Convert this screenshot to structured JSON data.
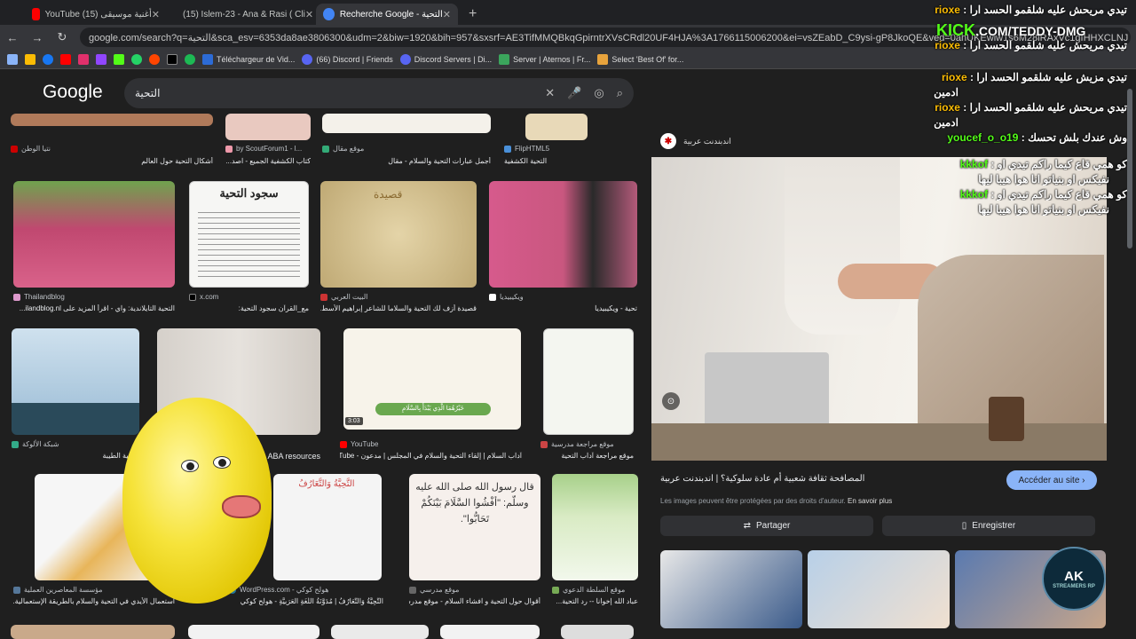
{
  "tabs": [
    {
      "label": "YouTube أغنية موسيقى (15)",
      "color": "#ff0000",
      "active": false
    },
    {
      "label": "(15) Islem-23 - Ana & Rasi ( Cli",
      "color": "#ff0000",
      "active": false
    },
    {
      "label": "Recherche Google - التحية",
      "color": "#4285f4",
      "active": true
    }
  ],
  "address": {
    "url": "google.com/search?q=التحية&sca_esv=6353da8ae3806300&udm=2&biw=1920&bih=957&sxsrf=AE3TifMMQBkqGpirntrXVsCRdl20UF4HJA%3A1766115006200&ei=vsZEabD_C9ysi-gP8JkoQE&ved=0ahUKEwiw1s6M28iRAxVc1gIHHXCLNJ"
  },
  "bookmarks": [
    {
      "label": "Téléchargeur de Vid...",
      "color": "#2c6bd6"
    },
    {
      "label": "(66) Discord | Friends",
      "color": "#5865f2"
    },
    {
      "label": "Discord Servers | Di...",
      "color": "#5865f2"
    },
    {
      "label": "Server | Aternos | Fr...",
      "color": "#3ba55c"
    },
    {
      "label": "Select 'Best Of' for...",
      "color": "#e8a33c"
    }
  ],
  "google": {
    "logo": "Google",
    "query": "التحية"
  },
  "grid": {
    "row0": [
      {
        "src": "نتيا الوطن",
        "cap": "أشكال التحية حول العالم",
        "color": "#b07a5a"
      },
      {
        "src": "by ScoutForum1 - l...",
        "cap": "كتاب الكشفية الجميع - اصد...",
        "color": "#e9c9c0"
      },
      {
        "src": "موقع مقال",
        "cap": "أجمل عبارات التحية والسلام - مقال",
        "color": "#f4f1ea"
      },
      {
        "src": "FlipHTML5",
        "cap": "التحية الكشفية",
        "color": "#e8d9b8"
      }
    ],
    "row1": [
      {
        "src": "Thailandblog",
        "cap": "التحية التايلاندية: واي - اقرأ المزيد على ilandblog.nl...",
        "color": "#c04870"
      },
      {
        "src": "x.com",
        "cap": "مع_القرآن سجود التحية:",
        "color": "#f1f1f1"
      },
      {
        "src": "البيت العربي",
        "cap": "قصيدة أزف لك التحية والسلاما للشاعر إبراهيم الأسط...",
        "color": "#d3c08f"
      },
      {
        "src": "ويكيبيديا",
        "cap": "تحية - ويكيبيديا",
        "color": "#c9577f"
      }
    ],
    "row2": [
      {
        "src": "شبكة الألوكة",
        "cap": "التحية الطيبة",
        "color": "#7fa8c8"
      },
      {
        "src": "",
        "cap": "ABA resources",
        "color": "#d7d2cc"
      },
      {
        "src": "YouTube",
        "cap": "آداب السلام | إلقاء التحية والسلام في المجلس | مدعون - uTube...",
        "color": "#f7f3ea",
        "duration": "3:03"
      },
      {
        "src": "موقع مراجعة مدرسية",
        "cap": "موقع مراجعة آداب التحية",
        "color": "#f4f6f0"
      }
    ],
    "row3": [
      {
        "src": "مؤسسة المعاصرين العملية",
        "cap": "استعمال الأيدي في التحية والسلام بالطريقة الإستعمالية...",
        "color": "#e8b55a"
      },
      {
        "src": "WordPress.com - هولح كوكي",
        "cap": "التَّحِيَّةُ وَالتَّعَارُفُ | مُدَوَّنَةُ اللُّغَةِ العَرَبِيَّةِ - هولح كوكي",
        "color": "#f4f4f4"
      },
      {
        "src": "موقع مدرسي",
        "cap": "أقوال حول التحية و افشاء السلام - موقع مدرسي",
        "color": "#f6f0ec"
      },
      {
        "src": "موقع السلطة الدعوي",
        "cap": "عباد الله إخوانا -- رد التحية...",
        "color": "#d9ebc4"
      }
    ]
  },
  "images_text": {
    "sujood": "سجود التحية",
    "qasida": "قصيدة",
    "hadith": "قال رسول الله صلى الله عليه وسلّم: \"أفْشُوا السَّلَامَ بَيْنَكُمْ تَحَابُّوا\".",
    "tahiya": "التَّحِيَّةُ وَالتَّعَارُفُ",
    "khayruhuma": "خَيْرُهُمَا الَّذِي يَبْدَأُ بِالسَّلَامِ"
  },
  "panel": {
    "source": "اندبندنت عربية",
    "title": "المصافحة ثقافة شعبية أم عادة سلوكية؟ | اندبندنت عربية",
    "visit": "Accéder au site",
    "rights": "Les images peuvent être protégées par des droits d'auteur.",
    "more": "En savoir plus",
    "share": "Partager",
    "save": "Enregistrer"
  },
  "chat": [
    {
      "user": "rioxe",
      "msg": "تيدي مريحش عليه شلقمو الحسد ارا"
    },
    {
      "user": "rioxe",
      "msg": "تيدي مريحش عليه شلقمو الحسد ارا"
    },
    {
      "user": "rioxe",
      "msg": "تيدي مزيش عليه شلقمو الحسد ارا"
    },
    {
      "user": "",
      "msg": "ادمين"
    },
    {
      "user": "rioxe",
      "msg": "تيدي مريحش عليه شلقمو الحسد ارا"
    },
    {
      "user": "",
      "msg": "ادمين"
    },
    {
      "user": "youcef_o_o19",
      "msg": "وش عندك بلش تحسك"
    },
    {
      "user": "kkkof",
      "msg": "كو همي قاع كيما راكم تيدي او"
    },
    {
      "user": "",
      "msg": "نفيكس او بنياتو انا هوا هيبا ليها"
    },
    {
      "user": "kkkof",
      "msg": "كو همي قاع كيما راكم تيدي او"
    },
    {
      "user": "",
      "msg": "نفيكس او بنياتو انا هوا هيبا ليها"
    }
  ],
  "kick": {
    "brand": "KICK",
    "handle": ".COM/TEDDY-DMG"
  },
  "overlay": {
    "ak": "AK",
    "ak_sub": "STREAMERS RP"
  }
}
